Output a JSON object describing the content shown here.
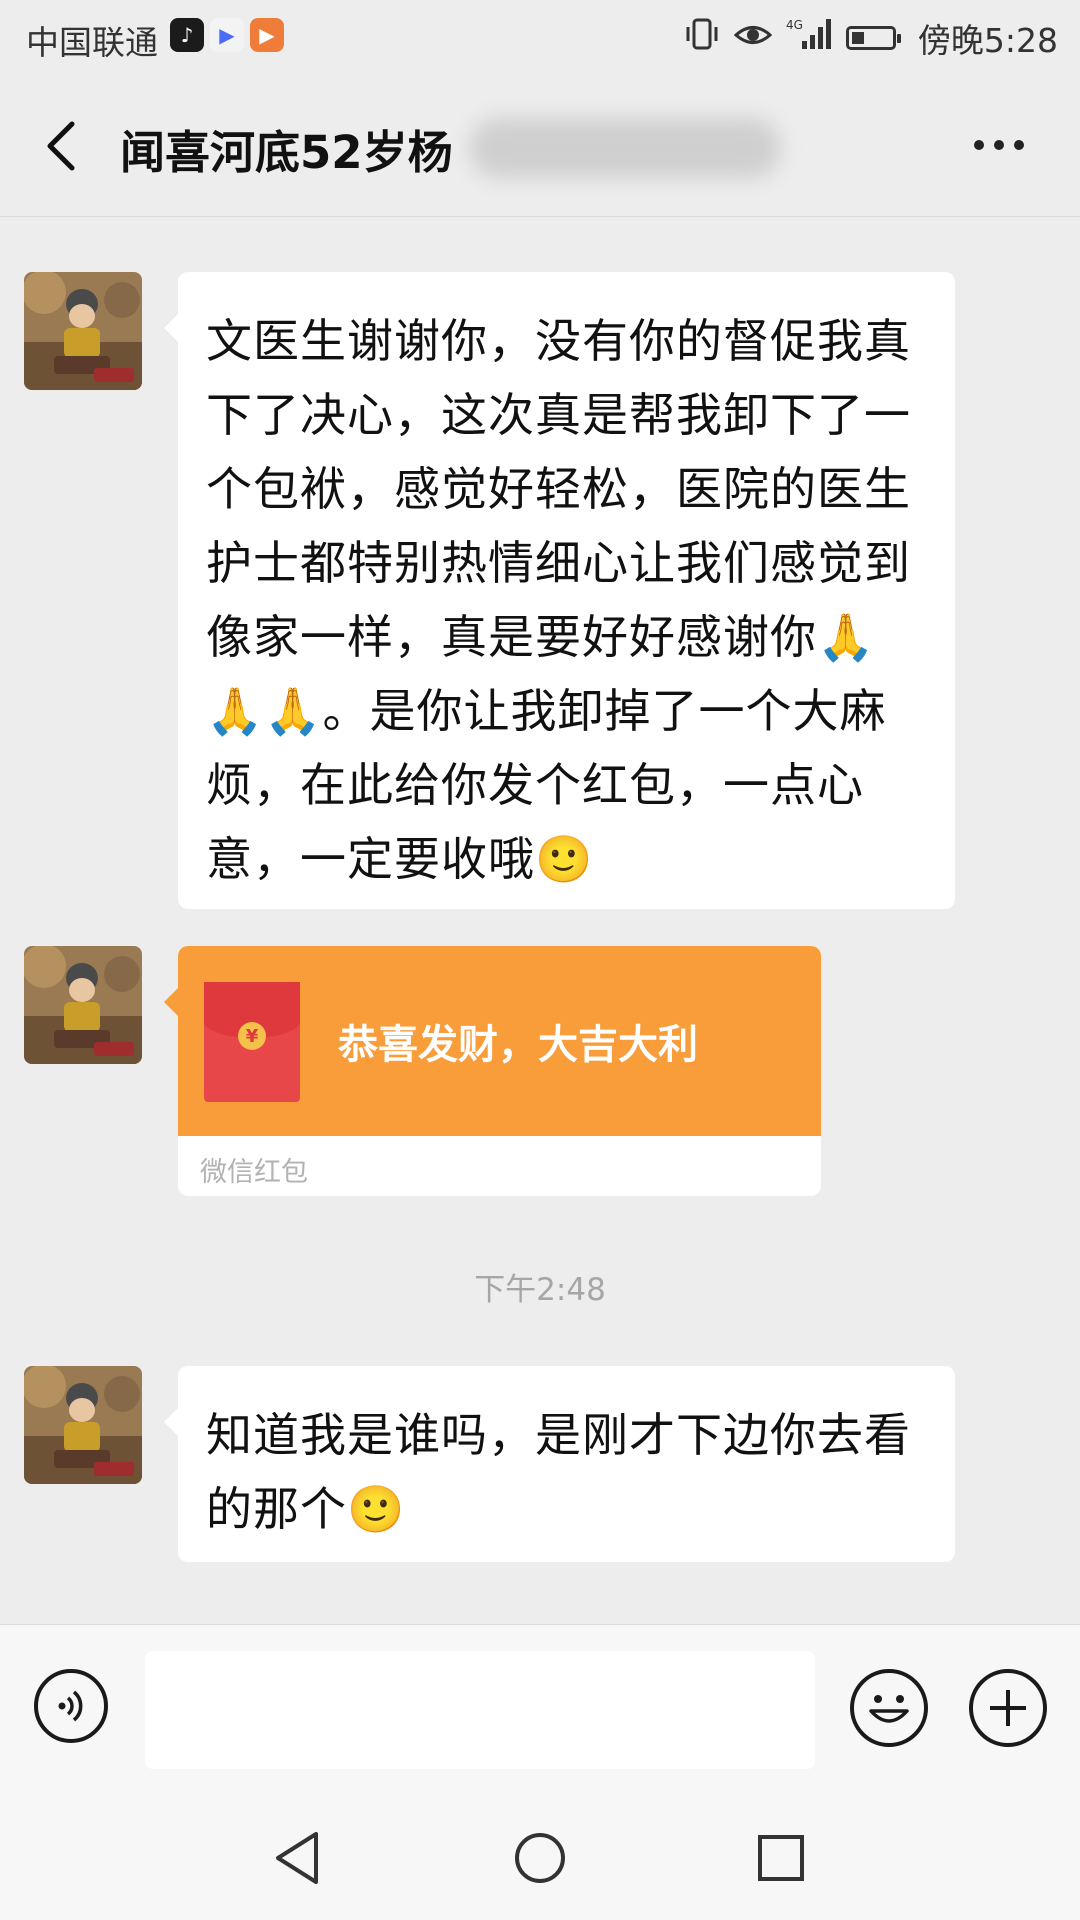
{
  "status_bar": {
    "carrier": "中国联通",
    "time": "傍晚5:28",
    "network": "4G"
  },
  "header": {
    "title": "闻喜河底52岁杨"
  },
  "messages": [
    {
      "type": "text",
      "text": "文医生谢谢你，没有你的督促我真下了决心，这次真是帮我卸下了一个包袱，感觉好轻松，医院的医生护士都特别热情细心让我们感觉到像家一样，真是要好好感谢你🙏🙏🙏。是你让我卸掉了一个大麻烦，在此给你发个红包，一点心意，一定要收哦🙂"
    },
    {
      "type": "red_packet",
      "greeting": "恭喜发财，大吉大利",
      "footer": "微信红包"
    },
    {
      "type": "timestamp",
      "text": "下午2:48"
    },
    {
      "type": "text",
      "text": "知道我是谁吗，是刚才下边你去看的那个🙂"
    }
  ],
  "input_bar": {
    "text": ""
  },
  "colors": {
    "background": "#ededed",
    "red_packet": "#f99d3b",
    "bubble": "#ffffff"
  }
}
